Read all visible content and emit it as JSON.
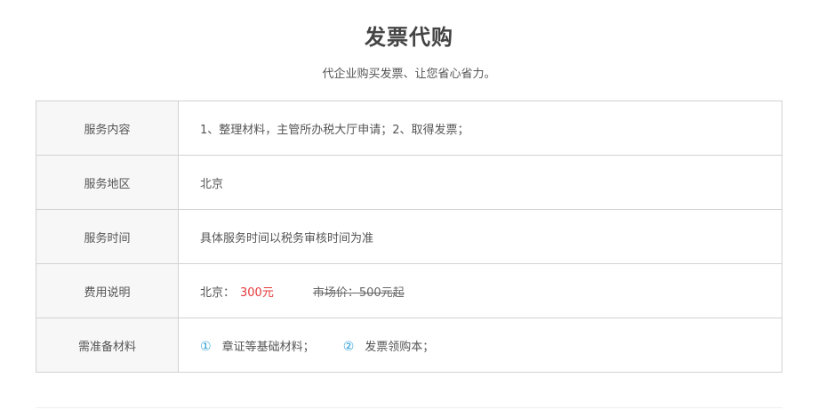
{
  "header": {
    "title": "发票代购",
    "subtitle": "代企业购买发票、让您省心省力。"
  },
  "table": {
    "content": {
      "label": "服务内容",
      "value": "1、整理材料，主管所办税大厅申请；2、取得发票；"
    },
    "region": {
      "label": "服务地区",
      "value": "北京"
    },
    "time": {
      "label": "服务时间",
      "value": "具体服务时间以税务审核时间为准"
    },
    "fee": {
      "label": "费用说明",
      "city": "北京：",
      "price": "300元",
      "market": "市场价：500元起"
    },
    "materials": {
      "label": "需准备材料",
      "items": [
        {
          "num": "①",
          "text": "章证等基础材料；"
        },
        {
          "num": "②",
          "text": "发票领购本；"
        }
      ]
    }
  },
  "colors": {
    "price": "#e4393c",
    "number_accent": "#2a9fd6",
    "label_bg": "#f7f7f7",
    "border": "#d2d2d2"
  }
}
